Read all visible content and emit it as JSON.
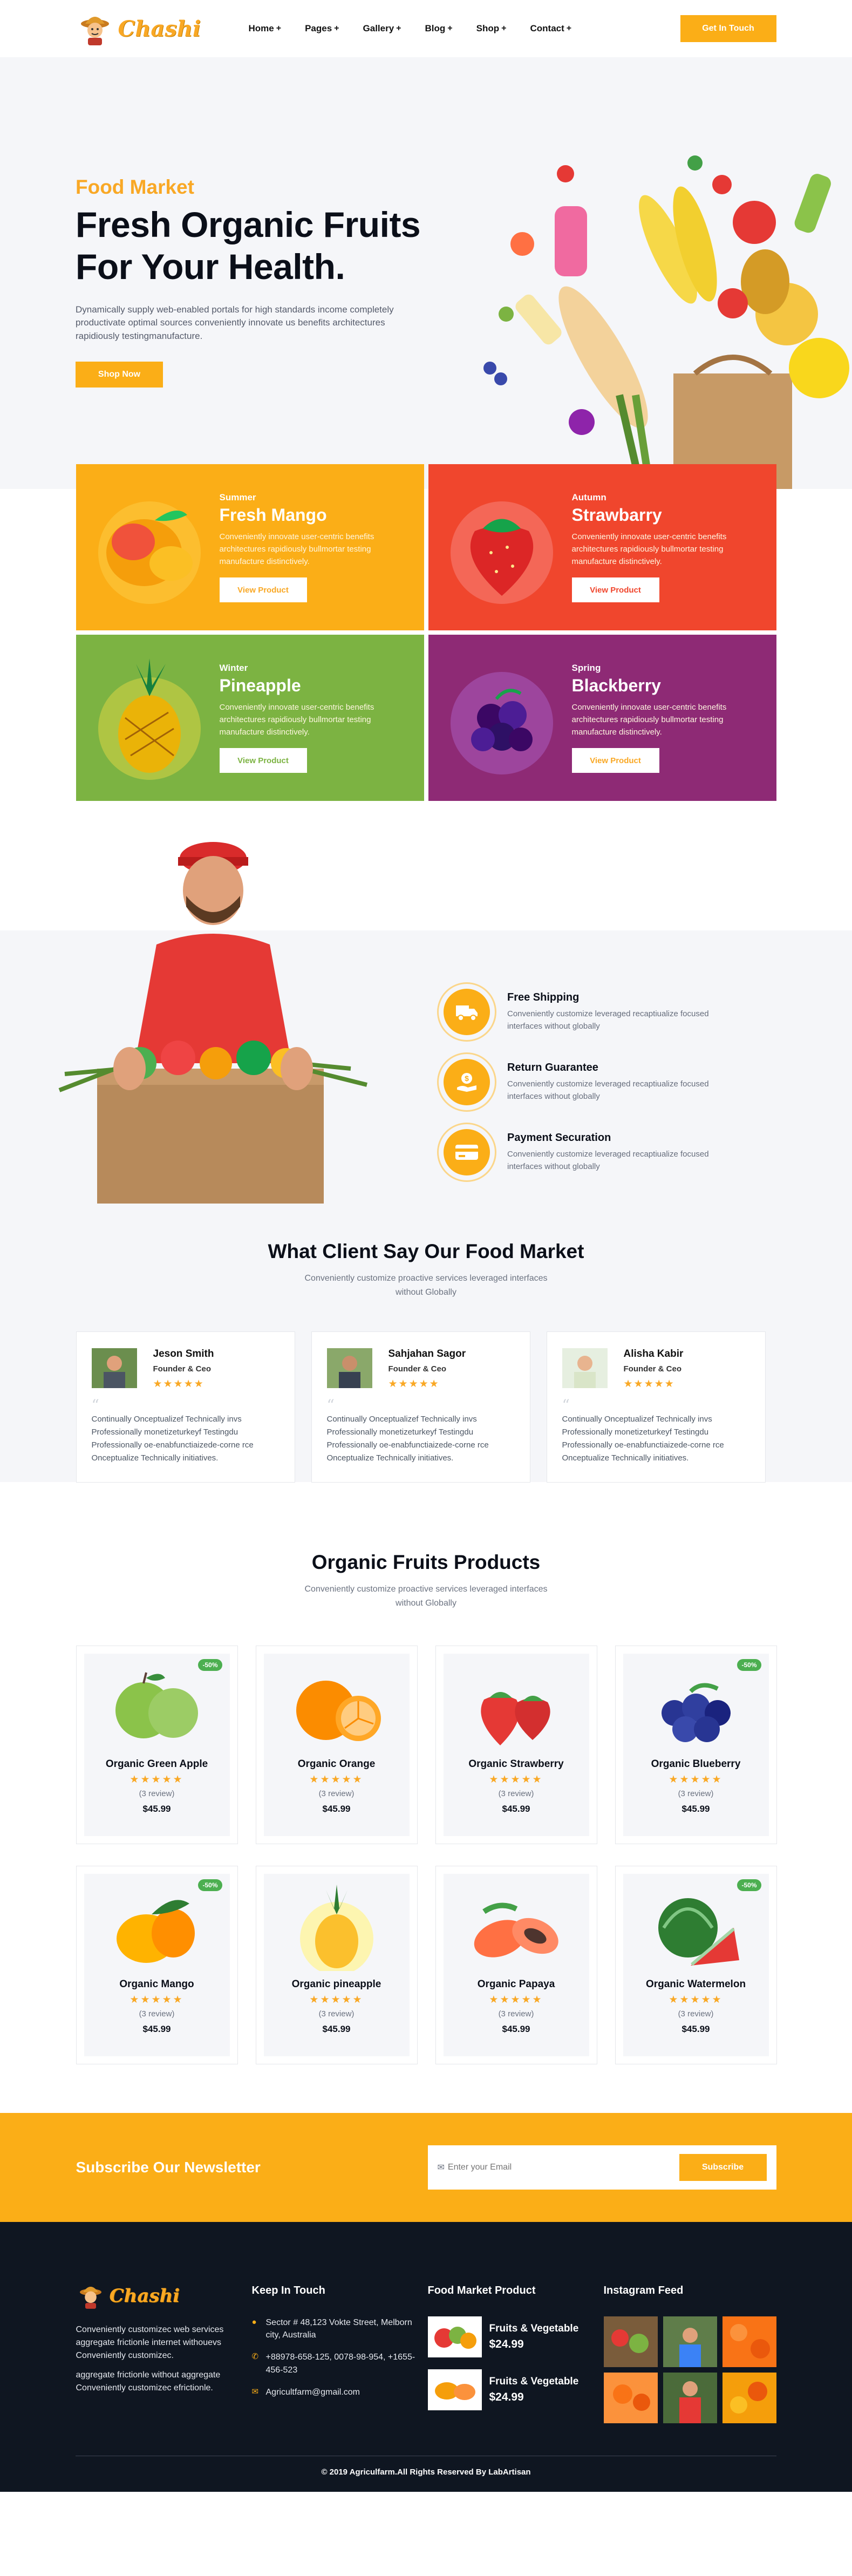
{
  "brand": {
    "name": "Chashi"
  },
  "nav": {
    "items": [
      {
        "label": "Home"
      },
      {
        "label": "Pages"
      },
      {
        "label": "Gallery"
      },
      {
        "label": "Blog"
      },
      {
        "label": "Shop"
      },
      {
        "label": "Contact"
      }
    ],
    "plus": "+",
    "cta": "Get In Touch"
  },
  "hero": {
    "kicker": "Food Market",
    "title_line1": "Fresh Organic Fruits",
    "title_line2": "For Your Health.",
    "description": "Dynamically supply web-enabled portals for high standards income completely productivate optimal sources conveniently innovate us benefits architectures rapidiously testingmanufacture.",
    "button": "Shop Now"
  },
  "categories": [
    {
      "season": "Summer",
      "name": "Fresh Mango",
      "description": "Conveniently innovate user-centric benefits architectures rapidiously bullmortar testing manufacture distinctively.",
      "button": "View Product",
      "color": "#f9a825"
    },
    {
      "season": "Autumn",
      "name": "Strawbarry",
      "description": "Conveniently innovate user-centric benefits architectures rapidiously bullmortar testing manufacture distinctively.",
      "button": "View Product",
      "color": "#f0462d"
    },
    {
      "season": "Winter",
      "name": "Pineapple",
      "description": "Conveniently innovate user-centric benefits architectures rapidiously bullmortar testing manufacture distinctively.",
      "button": "View Product",
      "color": "#7cb342"
    },
    {
      "season": "Spring",
      "name": "Blackberry",
      "description": "Conveniently innovate user-centric benefits architectures rapidiously bullmortar testing manufacture distinctively.",
      "button": "View Product",
      "color": "#8e2a75"
    }
  ],
  "features": [
    {
      "icon": "truck-icon",
      "title": "Free Shipping",
      "description": "Conveniently customize leveraged recaptiualize focused interfaces without globally"
    },
    {
      "icon": "money-hand-icon",
      "title": "Return Guarantee",
      "description": "Conveniently customize leveraged recaptiualize focused interfaces without globally"
    },
    {
      "icon": "credit-card-icon",
      "title": "Payment Securation",
      "description": "Conveniently customize leveraged recaptiualize focused interfaces without globally"
    }
  ],
  "testimonials": {
    "title": "What Client Say Our Food Market",
    "subtitle": "Conveniently customize proactive services leveraged interfaces without Globally",
    "items": [
      {
        "name": "Jeson Smith",
        "role": "Founder & Ceo",
        "stars": "★★★★★",
        "quote": "Continually Onceptualizef Technically invs Professionally monetizeturkeyf Testingdu Professionally oe-enabfunctiaizede-corne rce Onceptualize Technically initiatives."
      },
      {
        "name": "Sahjahan Sagor",
        "role": "Founder & Ceo",
        "stars": "★★★★★",
        "quote": "Continually Onceptualizef Technically invs Professionally monetizeturkeyf Testingdu Professionally oe-enabfunctiaizede-corne rce Onceptualize Technically initiatives."
      },
      {
        "name": "Alisha Kabir",
        "role": "Founder & Ceo",
        "stars": "★★★★★",
        "quote": "Continually Onceptualizef Technically invs Professionally monetizeturkeyf Testingdu Professionally oe-enabfunctiaizede-corne rce Onceptualize Technically initiatives."
      }
    ]
  },
  "products": {
    "title": "Organic Fruits Products",
    "subtitle": "Conveniently customize proactive services leveraged interfaces without Globally",
    "items": [
      {
        "name": "Organic Green Apple",
        "stars": "★★★★★",
        "review": "(3 review)",
        "price": "$45.99",
        "badge": "-50%"
      },
      {
        "name": "Organic Orange",
        "stars": "★★★★★",
        "review": "(3 review)",
        "price": "$45.99",
        "badge": ""
      },
      {
        "name": "Organic Strawberry",
        "stars": "★★★★★",
        "review": "(3 review)",
        "price": "$45.99",
        "badge": ""
      },
      {
        "name": "Organic Blueberry",
        "stars": "★★★★★",
        "review": "(3 review)",
        "price": "$45.99",
        "badge": "-50%"
      },
      {
        "name": "Organic Mango",
        "stars": "★★★★★",
        "review": "(3 review)",
        "price": "$45.99",
        "badge": "-50%"
      },
      {
        "name": "Organic pineapple",
        "stars": "★★★★★",
        "review": "(3 review)",
        "price": "$45.99",
        "badge": ""
      },
      {
        "name": "Organic Papaya",
        "stars": "★★★★★",
        "review": "(3 review)",
        "price": "$45.99",
        "badge": ""
      },
      {
        "name": "Organic Watermelon",
        "stars": "★★★★★",
        "review": "(3 review)",
        "price": "$45.99",
        "badge": "-50%"
      }
    ]
  },
  "newsletter": {
    "title": "Subscribe Our Newsletter",
    "placeholder": "Enter your Email",
    "button": "Subscribe"
  },
  "footer": {
    "about": [
      "Conveniently customizec web services aggregate frictionle internet withouevs Conveniently customizec.",
      "aggregate frictionle without aggregate Conveniently customizec efrictionle."
    ],
    "contact_title": "Keep In Touch",
    "address": "Sector # 48,123 Vokte Street, Melborn city, Australia",
    "phone": "+88978-658-125, 0078-98-954, +1655-456-523",
    "email": "Agricultfarm@gmail.com",
    "products_title": "Food Market Product",
    "products": [
      {
        "name": "Fruits & Vegetable",
        "price": "$24.99"
      },
      {
        "name": "Fruits & Vegetable",
        "price": "$24.99"
      }
    ],
    "instagram_title": "Instagram Feed",
    "copyright": "© 2019 Agriculfarm.All Rights Reserved By LabArtisan"
  },
  "colors": {
    "accent": "#fbae17",
    "dark": "#0f1621",
    "light_bg": "#f5f6f9"
  }
}
